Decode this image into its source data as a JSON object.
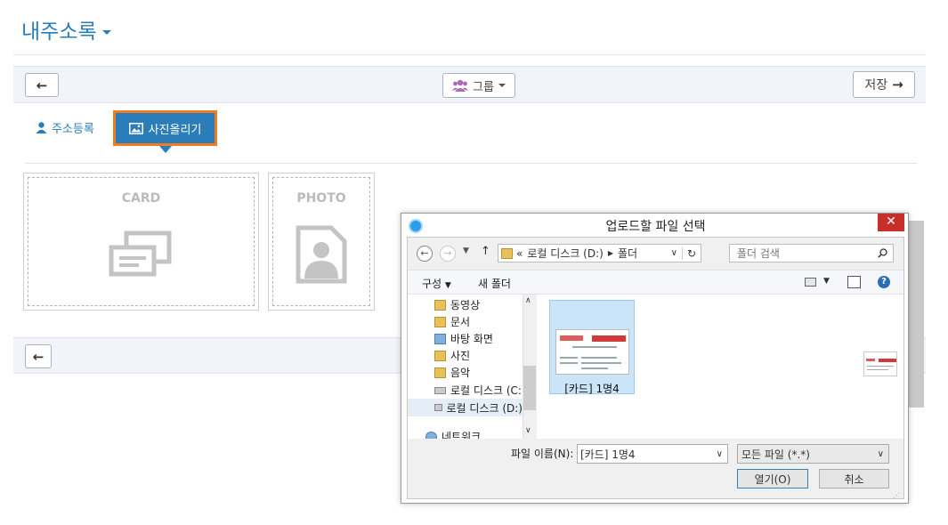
{
  "page": {
    "title": "내주소록",
    "toolbar": {
      "group_label": "그룹",
      "save_label": "저장"
    },
    "tabs": [
      {
        "label": "주소등록"
      },
      {
        "label": "사진올리기"
      }
    ],
    "boxes": {
      "card_label": "CARD",
      "photo_label": "PHOTO"
    }
  },
  "dialog": {
    "title": "업로드할 파일 선택",
    "close_glyph": "✕",
    "address": {
      "prefix": "«",
      "path": [
        "로컬 디스크 (D:)",
        "폴더"
      ]
    },
    "search_placeholder": "폴더 검색",
    "commands": {
      "organize": "구성",
      "new_folder": "새 폴더"
    },
    "tree": [
      {
        "label": "동영상",
        "icon": "folder-icon"
      },
      {
        "label": "문서",
        "icon": "folder-icon"
      },
      {
        "label": "바탕 화면",
        "icon": "folder-icon"
      },
      {
        "label": "사진",
        "icon": "folder-icon"
      },
      {
        "label": "음악",
        "icon": "folder-icon"
      },
      {
        "label": "로컬 디스크 (C:)",
        "icon": "drive-icon"
      },
      {
        "label": "로컬 디스크 (D:)",
        "icon": "drive-icon"
      },
      {
        "label": "네트워크",
        "icon": "network-icon"
      }
    ],
    "files": [
      {
        "name": "[카드] 1명4",
        "selected": true
      }
    ],
    "file_name_label": "파일 이름(N):",
    "file_name_value": "[카드] 1명4",
    "file_type_value": "모든 파일 (*.*)",
    "open_label": "열기(O)",
    "cancel_label": "취소"
  },
  "colors": {
    "accent": "#2a7db8",
    "highlight_border": "#f07c24",
    "close_red": "#c7302a"
  }
}
